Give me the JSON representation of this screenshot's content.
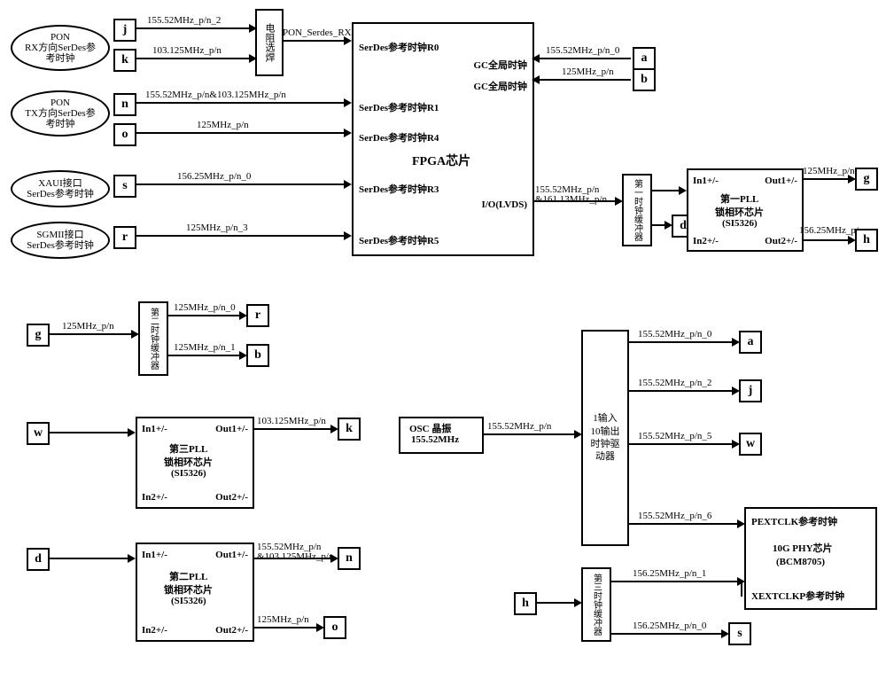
{
  "ellipses": {
    "pon_rx": "PON\nRX方向SerDes参\n考时钟",
    "pon_tx": "PON\nTX方向SerDes参\n考时钟",
    "xaui": "XAUI接口\nSerDes参考时钟",
    "sgmii": "SGMII接口\nSerDes参考时钟"
  },
  "nodes": {
    "j": "j",
    "k": "k",
    "n": "n",
    "o": "o",
    "s": "s",
    "r": "r",
    "a": "a",
    "b": "b",
    "g": "g",
    "h": "h",
    "d": "d",
    "r2": "r",
    "b2": "b",
    "g2": "g",
    "k2": "k",
    "w": "w",
    "d2": "d",
    "n2": "n",
    "o2": "o",
    "h2": "h",
    "s2": "s",
    "a2": "a",
    "j2": "j",
    "w2": "w"
  },
  "vboxes": {
    "res": "电阻选焊",
    "buf1": "第一时钟缓冲器",
    "buf2": "第二时钟缓冲器",
    "buf3": "第三时钟缓冲器",
    "drv": "1输入\n10输出\n时钟驱\n动器"
  },
  "signals": {
    "s155_2": "155.52MHz_p/n_2",
    "s103": "103.125MHz_p/n",
    "s155_103": "155.52MHz_p/n&103.125MHz_p/n",
    "s125": "125MHz_p/n",
    "s12525": "156.25MHz_p/n_0",
    "s125_3": "125MHz_p/n_3",
    "pon_rx": "PON_Serdes_RX",
    "s155_0": "155.52MHz_p/n_0",
    "s125b": "125MHz_p/n",
    "s155_161": "155.52MHz_p/n\n&161.13MHz_p/n",
    "s125g": "125MHz_p/n",
    "s15625g": "156.25MHz_p/n",
    "s125pn": "125MHz_p/n",
    "s125pn0": "125MHz_p/n_0",
    "s125pn1": "125MHz_p/n_1",
    "s103k": "103.125MHz_p/n",
    "s155_103n": "155.52MHz_p/n\n&103.125MHz_p/n",
    "s125o": "125MHz_p/n",
    "s155pn": "155.52MHz_p/n",
    "s155_5": "155.52MHz_p/n_5",
    "s155_6": "155.52MHz_p/n_6",
    "s15625_1": "156.25MHz_p/n_1",
    "s15625_0": "156.25MHz_p/n_0"
  },
  "fpga": {
    "title": "FPGA芯片",
    "r0": "SerDes参考时钟R0",
    "r1": "SerDes参考时钟R1",
    "r4": "SerDes参考时钟R4",
    "r3": "SerDes参考时钟R3",
    "r5": "SerDes参考时钟R5",
    "io": "I/O(LVDS)",
    "gc1": "GC全局时钟",
    "gc2": "GC全局时钟"
  },
  "pll1": {
    "in1": "In1+/-",
    "in2": "In2+/-",
    "out1": "Out1+/-",
    "out2": "Out2+/-",
    "t1": "第一PLL",
    "t2": "锁相环芯片",
    "t3": "(SI5326)"
  },
  "pll2": {
    "in1": "In1+/-",
    "in2": "In2+/-",
    "out1": "Out1+/-",
    "out2": "Out2+/-",
    "t1": "第二PLL",
    "t2": "锁相环芯片",
    "t3": "(SI5326)"
  },
  "pll3": {
    "in1": "In1+/-",
    "in2": "In2+/-",
    "out1": "Out1+/-",
    "out2": "Out2+/-",
    "t1": "第三PLL",
    "t2": "锁相环芯片",
    "t3": "(SI5326)"
  },
  "osc": {
    "t1": "OSC 晶振",
    "t2": "155.52MHz"
  },
  "phy": {
    "p1": "PEXTCLK参考时钟",
    "p2": "10G PHY芯片",
    "p3": "(BCM8705)",
    "p4": "XEXTCLKP参考时钟"
  }
}
